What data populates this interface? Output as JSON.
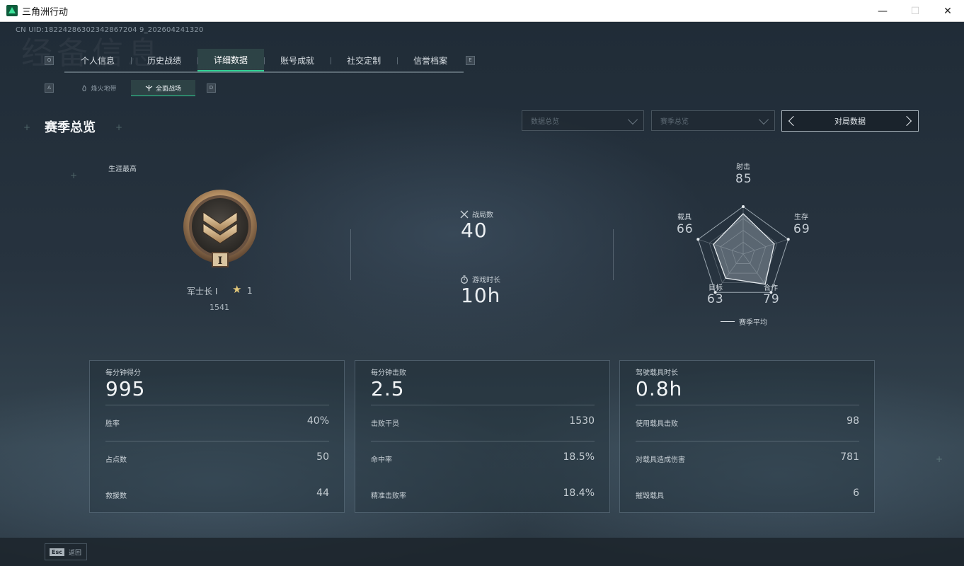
{
  "window": {
    "title": "三角洲行动",
    "controls": {
      "minimize": "—",
      "maximize": "☐",
      "close": "✕"
    }
  },
  "header": {
    "uid": "CN UID:18224286302342867204 9_202604241320",
    "bg_title": "经备信息",
    "tab_key_left": "Q",
    "tab_key_right": "E",
    "tabs": [
      {
        "label": "个人信息",
        "active": false
      },
      {
        "label": "历史战绩",
        "active": false
      },
      {
        "label": "详细数据",
        "active": true
      },
      {
        "label": "账号成就",
        "active": false
      },
      {
        "label": "社交定制",
        "active": false
      },
      {
        "label": "信誉档案",
        "active": false
      }
    ],
    "subtab_key_left": "A",
    "subtab_key_right": "D",
    "subtabs": [
      {
        "label": "烽火地带",
        "icon": "flame-icon",
        "active": false
      },
      {
        "label": "全面战场",
        "icon": "battlefield-icon",
        "active": true
      }
    ]
  },
  "section": {
    "title": "赛季总览",
    "filters": [
      {
        "value": "数据总览"
      },
      {
        "value": "赛季总览"
      }
    ],
    "pager_label": "对局数据"
  },
  "career": {
    "label": "生涯最高",
    "rank_name": "军士长 I",
    "star_icon": "star-icon",
    "level": "1",
    "points": "1541",
    "medal_numeral": "I"
  },
  "match_stats": {
    "matches_label": "战局数",
    "matches_value": "40",
    "time_label": "游戏时长",
    "time_value": "10h"
  },
  "radar": {
    "axes": [
      {
        "label": "射击",
        "value": 85
      },
      {
        "label": "生存",
        "value": 69
      },
      {
        "label": "合作",
        "value": 79
      },
      {
        "label": "目标",
        "value": 63
      },
      {
        "label": "载具",
        "value": 66
      }
    ],
    "max": 100,
    "legend": "赛季平均"
  },
  "cards": [
    {
      "title": "每分钟得分",
      "value": "995",
      "rows": [
        {
          "label": "胜率",
          "value": "40%"
        },
        {
          "label": "占点数",
          "value": "50"
        },
        {
          "label": "救援数",
          "value": "44"
        }
      ]
    },
    {
      "title": "每分钟击败",
      "value": "2.5",
      "rows": [
        {
          "label": "击败干员",
          "value": "1530"
        },
        {
          "label": "命中率",
          "value": "18.5%"
        },
        {
          "label": "精准击败率",
          "value": "18.4%"
        }
      ]
    },
    {
      "title": "驾驶载具时长",
      "value": "0.8h",
      "rows": [
        {
          "label": "使用载具击败",
          "value": "98"
        },
        {
          "label": "对载具造成伤害",
          "value": "781"
        },
        {
          "label": "摧毁载具",
          "value": "6"
        }
      ]
    }
  ],
  "footer": {
    "esc_key": "Esc",
    "back_label": "返回"
  },
  "colors": {
    "accent": "#2fd495",
    "star": "#e5c97a"
  }
}
